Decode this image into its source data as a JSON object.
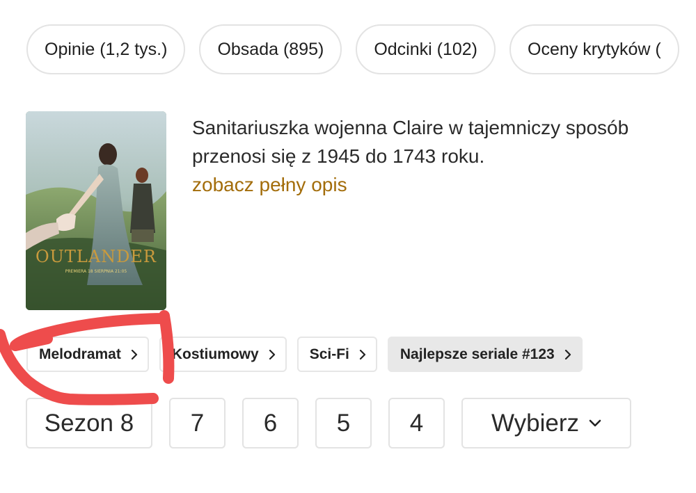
{
  "tabs": [
    {
      "label": "Opinie (1,2 tys.)"
    },
    {
      "label": "Obsada (895)"
    },
    {
      "label": "Odcinki (102)"
    },
    {
      "label": "Oceny krytyków ("
    }
  ],
  "poster": {
    "title_text": "OUTLANDER",
    "subtitle_text": "PREMIERA 18 SIERPNIA 21:05"
  },
  "description": {
    "text": "Sanitariuszka wojenna Claire w tajemniczy sposób przenosi się z 1945 do 1743 roku.",
    "more_link": "zobacz pełny opis"
  },
  "genres": [
    {
      "label": "Melodramat"
    },
    {
      "label": "Kostiumowy"
    },
    {
      "label": "Sci-Fi"
    },
    {
      "label": "Najlepsze seriale #123"
    }
  ],
  "seasons": {
    "current": "Sezon 8",
    "others": [
      "7",
      "6",
      "5",
      "4"
    ],
    "choose_label": "Wybierz"
  },
  "colors": {
    "link": "#a36d0b",
    "annotation": "#ee4c4c",
    "ranked_chip_bg": "#e8e8e8"
  },
  "icons": {
    "chip_arrow": "chevron-right-icon",
    "select_arrow": "chevron-down-icon"
  }
}
